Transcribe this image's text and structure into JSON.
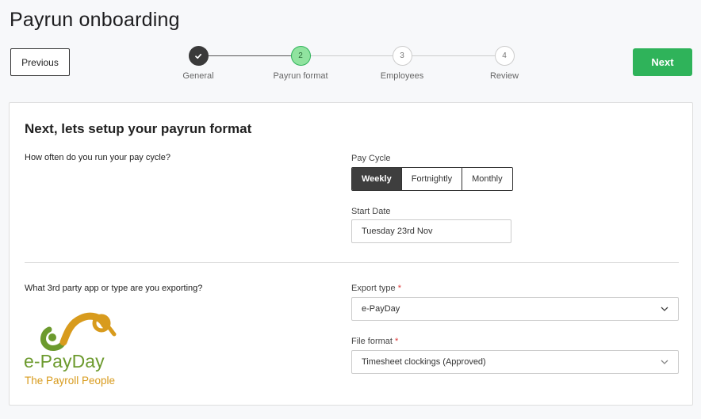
{
  "page": {
    "title": "Payrun onboarding"
  },
  "nav": {
    "previous_label": "Previous",
    "next_label": "Next"
  },
  "stepper": {
    "steps": [
      {
        "number": "",
        "label": "General",
        "state": "completed"
      },
      {
        "number": "2",
        "label": "Payrun format",
        "state": "active"
      },
      {
        "number": "3",
        "label": "Employees",
        "state": "upcoming"
      },
      {
        "number": "4",
        "label": "Review",
        "state": "upcoming"
      }
    ]
  },
  "form": {
    "heading": "Next, lets setup your payrun format",
    "pay_cycle_question": "How often do you run your pay cycle?",
    "pay_cycle": {
      "label": "Pay Cycle",
      "options": [
        "Weekly",
        "Fortnightly",
        "Monthly"
      ],
      "selected": "Weekly"
    },
    "start_date": {
      "label": "Start Date",
      "value": "Tuesday 23rd Nov"
    },
    "export_question": "What 3rd party app or type are you exporting?",
    "export_type": {
      "label": "Export type",
      "required_mark": "*",
      "value": "e-PayDay"
    },
    "file_format": {
      "label": "File format",
      "required_mark": "*",
      "value": "Timesheet clockings (Approved)"
    },
    "logo": {
      "name": "e-PayDay",
      "tagline": "The Payroll People"
    }
  },
  "colors": {
    "primary": "#2fb35a",
    "active_step": "#90e39f",
    "dark": "#3e3e3e",
    "logo_green": "#6c9a2e",
    "logo_orange": "#d89b1d"
  }
}
